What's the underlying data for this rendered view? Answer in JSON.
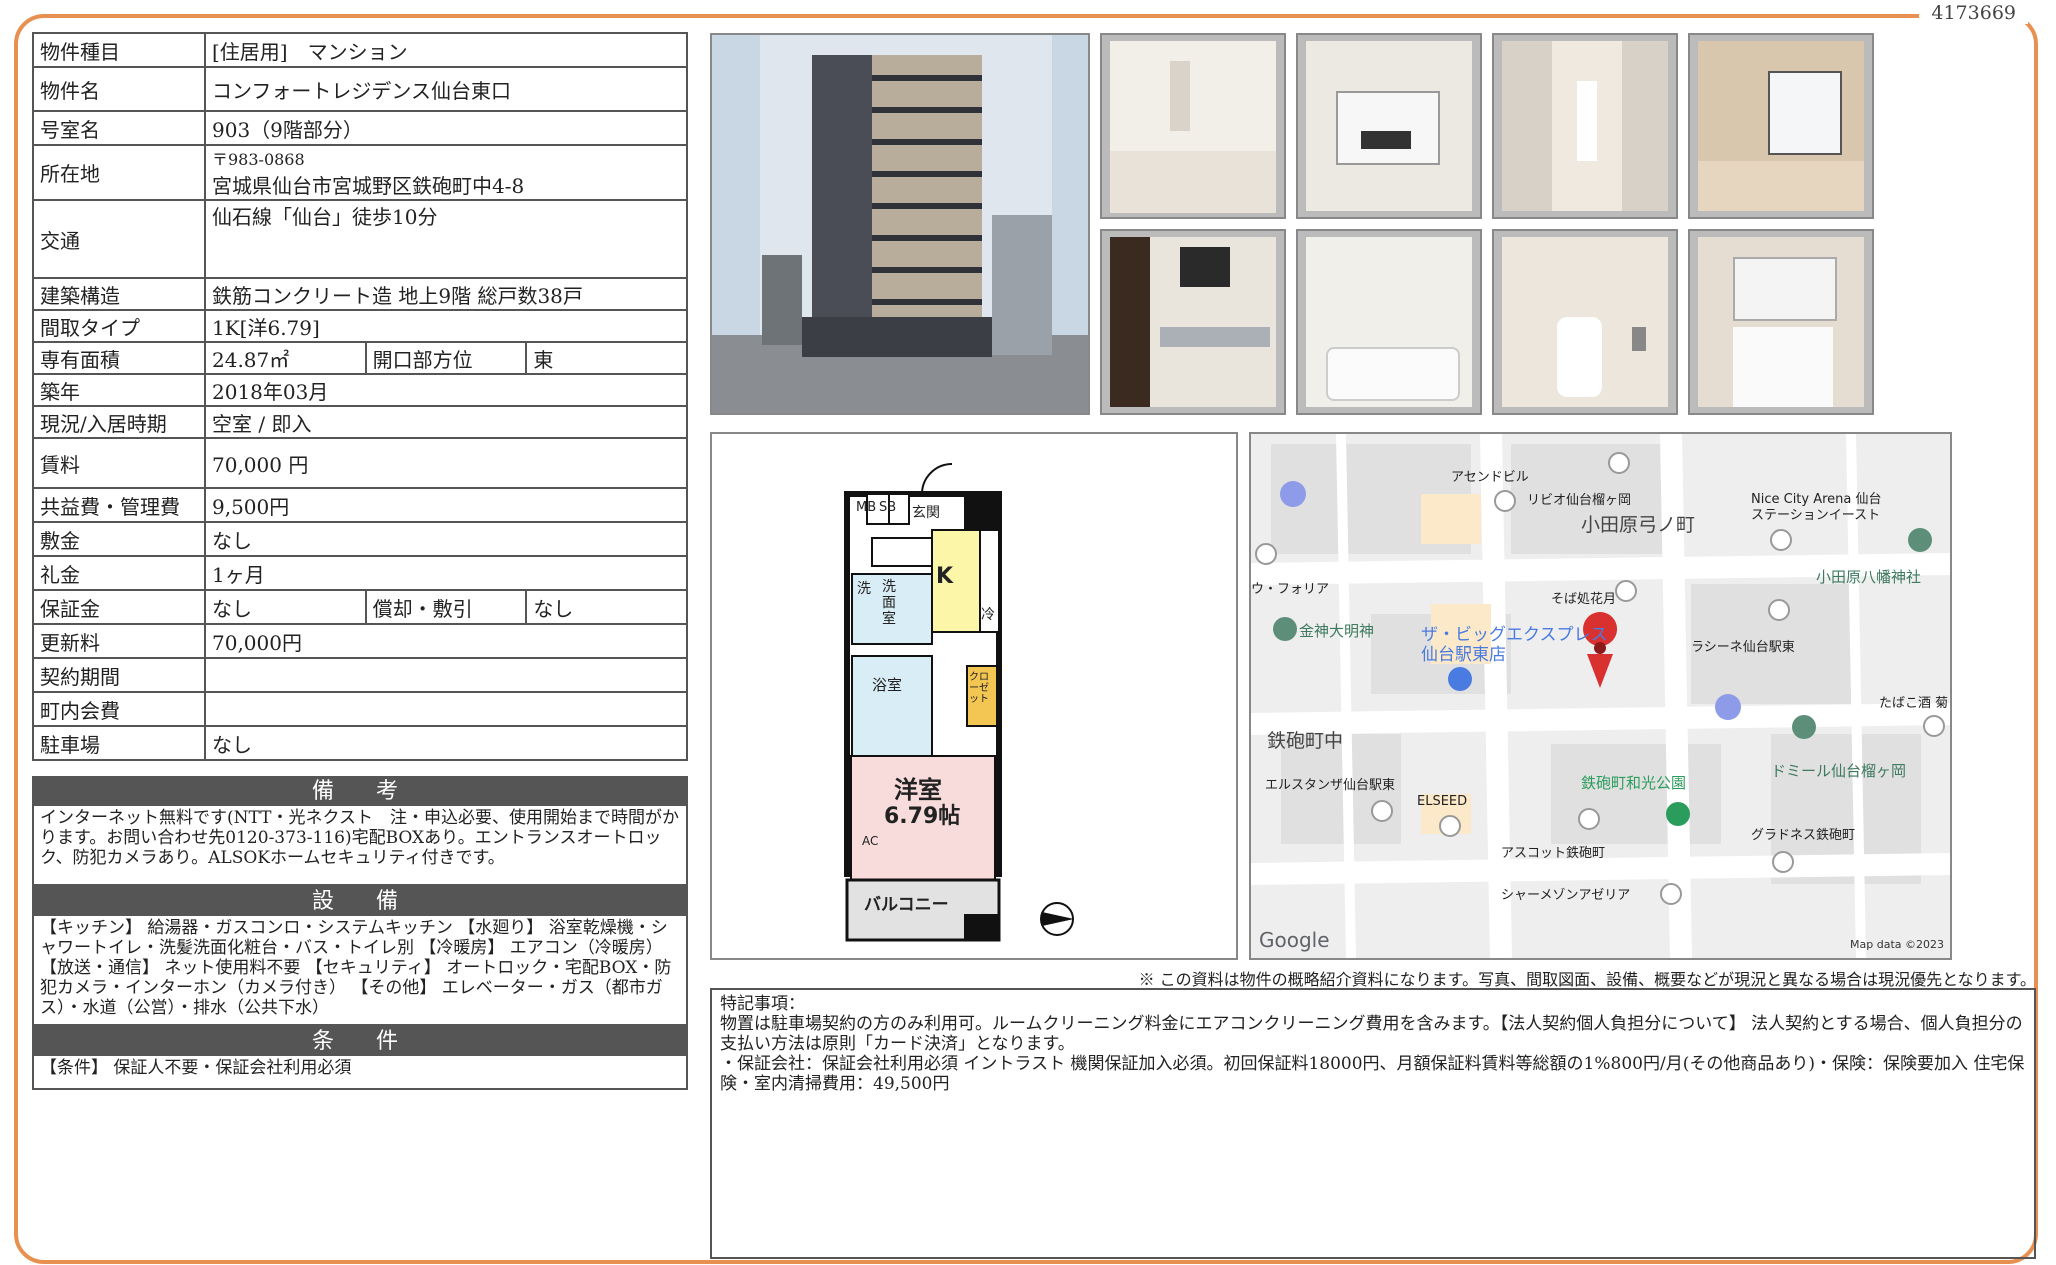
{
  "ref_no": "4173669",
  "spec": {
    "type_label": "物件種目",
    "type_value": "[住居用]　マンション",
    "name_label": "物件名",
    "name_value": "コンフォートレジデンス仙台東口",
    "room_label": "号室名",
    "room_value": "903（9階部分）",
    "address_label": "所在地",
    "postal": "〒983-0868",
    "address_value": "宮城県仙台市宮城野区鉄砲町中4-8",
    "transport_label": "交通",
    "transport_value": "仙石線「仙台」徒歩10分",
    "structure_label": "建築構造",
    "structure_value": "鉄筋コンクリート造 地上9階 総戸数38戸",
    "layout_label": "間取タイプ",
    "layout_value": "1K[洋6.79]",
    "area_label": "専有面積",
    "area_value": "24.87㎡",
    "direction_label": "開口部方位",
    "direction_value": "東",
    "built_label": "築年",
    "built_value": "2018年03月",
    "status_label": "現況/入居時期",
    "status_value": "空室 / 即入",
    "rent_label": "賃料",
    "rent_value": "70,000 円",
    "fee_label": "共益費・管理費",
    "fee_value": "9,500円",
    "deposit_label": "敷金",
    "deposit_value": "なし",
    "key_label": "礼金",
    "key_value": "1ヶ月",
    "guarantee_label": "保証金",
    "guarantee_value": "なし",
    "amort_label": "償却・敷引",
    "amort_value": "なし",
    "renewal_label": "更新料",
    "renewal_value": "70,000円",
    "contract_label": "契約期間",
    "contract_value": "",
    "community_label": "町内会費",
    "community_value": "",
    "parking_label": "駐車場",
    "parking_value": "なし"
  },
  "remarks": {
    "heading": "備　考",
    "text": "インターネット無料です(NTT・光ネクスト　注・申込必要、使用開始まで時間がかります。お問い合わせ先0120-373-116)宅配BOXあり。エントランスオートロック、防犯カメラあり。ALSOKホームセキュリティ付きです。"
  },
  "facilities": {
    "heading": "設　備",
    "text": "【キッチン】 給湯器・ガスコンロ・システムキッチン 【水廻り】 浴室乾燥機・シャワートイレ・洗髪洗面化粧台・バス・トイレ別 【冷暖房】 エアコン（冷暖房） 【放送・通信】 ネット使用料不要 【セキュリティ】 オートロック・宅配BOX・防犯カメラ・インターホン（カメラ付き） 【その他】 エレベーター・ガス（都市ガス）・水道（公営）・排水（公共下水）"
  },
  "conditions": {
    "heading": "条　件",
    "text": "【条件】 保証人不要・保証会社利用必須"
  },
  "floorplan": {
    "mb": "MB",
    "sb": "SB",
    "entrance": "玄関",
    "k": "K",
    "wash": "洗",
    "washroom": "洗面室",
    "fridge": "冷",
    "closet": "クローゼット",
    "bath": "浴室",
    "room": "洋室",
    "room_size": "6.79帖",
    "ac": "AC",
    "balcony": "バルコニー"
  },
  "map": {
    "labels": [
      "アセンドビル",
      "リビオ仙台榴ヶ岡",
      "Nice City Arena 仙台",
      "ステーションイースト",
      "小田原弓ノ町",
      "小田原八幡神社",
      "ウ・フォリア",
      "そば処花月",
      "金神大明神",
      "ザ・ビッグエクスプレス",
      "仙台駅東店",
      "ラシーネ仙台駅東",
      "たばこ酒 菊",
      "鉄砲町中",
      "ドミール仙台榴ヶ岡",
      "エルスタンザ仙台駅東",
      "ELSEED",
      "鉄砲町和光公園",
      "グラドネス鉄砲町",
      "アスコット鉄砲町",
      "シャーメゾンアゼリア"
    ],
    "logo": "Google",
    "copyright": "Map data ©2023"
  },
  "note": "※ この資料は物件の概略紹介資料になります。写真、間取図面、設備、概要などが現況と異なる場合は現況優先となります。",
  "special": {
    "title": "特記事項：",
    "line1": "物置は駐車場契約の方のみ利用可。ルームクリーニング料金にエアコンクリーニング費用を含みます。【法人契約個人負担分について】 法人契約とする場合、個人負担分の支払い方法は原則「カード決済」となります。",
    "line2": "・保証会社：保証会社利用必須 イントラスト 機関保証加入必須。初回保証料18000円、月額保証料賃料等総額の1%800円/月(その他商品あり)・保険：保険要加入 住宅保険・室内清掃費用：49,500円"
  },
  "colors": {
    "frame": "#e8904f",
    "header": "#555555",
    "pin": "#d93030",
    "park": "#2a9d5c"
  }
}
